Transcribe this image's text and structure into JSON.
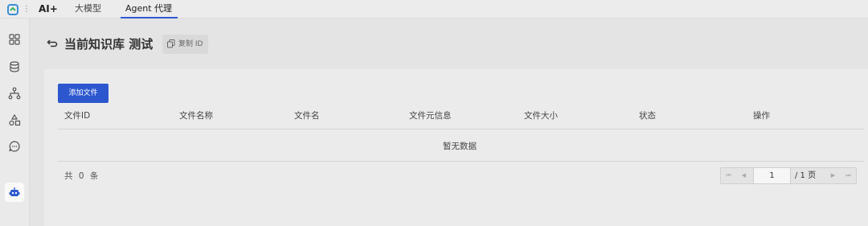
{
  "header": {
    "brand": "AI+",
    "tabs": [
      {
        "label": "大模型"
      },
      {
        "label": "Agent 代理",
        "active": true
      }
    ]
  },
  "sidebar": {
    "items": [
      {
        "icon": "grid-icon"
      },
      {
        "icon": "database-icon"
      },
      {
        "icon": "network-icon"
      },
      {
        "icon": "shapes-icon"
      },
      {
        "icon": "chat-icon"
      },
      {
        "icon": "robot-icon",
        "active": true
      }
    ]
  },
  "page": {
    "title": "当前知识库 测试",
    "copy_id_label": "复制 ID"
  },
  "toolbar": {
    "add_file_label": "添加文件"
  },
  "table": {
    "columns": [
      "文件ID",
      "文件名称",
      "文件名",
      "文件元信息",
      "文件大小",
      "状态",
      "操作"
    ],
    "rows": [],
    "empty_text": "暂无数据"
  },
  "pagination": {
    "total_text": "共 0 条",
    "current_page": "1",
    "total_pages_text": "/ 1 页"
  },
  "colors": {
    "accent": "#2c57cf",
    "background": "#e4e4e4"
  }
}
